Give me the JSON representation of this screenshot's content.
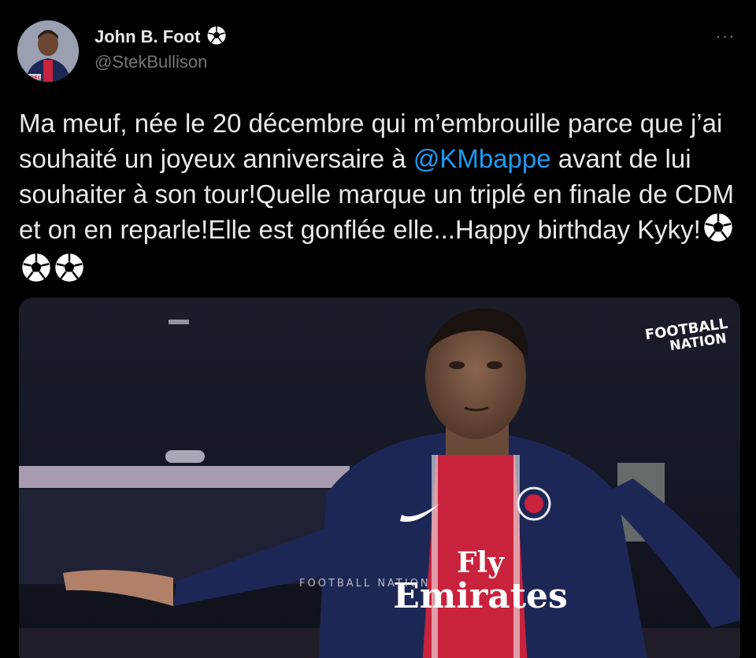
{
  "author": {
    "display_name": "John B. Foot",
    "handle": "@StekBullison",
    "name_badge_icon": "soccer-ball-icon",
    "avatar_alt": "profile-avatar"
  },
  "more_menu": {
    "label": "···"
  },
  "tweet": {
    "text_before_mention": "Ma meuf, née le 20 décembre qui m’embrouille parce que j’ai souhaité un joyeux anniversaire à ",
    "mention": "@KMbappe",
    "text_after_mention": " avant de lui souhaiter à son tour!Quelle marque un triplé en finale de CDM et on en reparle!Elle est gonflée elle...Happy birthday Kyky!",
    "trailing_emoji_count": 3,
    "trailing_emoji_icon": "soccer-ball-icon"
  },
  "media": {
    "type": "video-thumbnail",
    "watermark_line1": "FOOTBALL",
    "watermark_line2": "NATION",
    "shirt_sponsor_line1": "Fly",
    "shirt_sponsor_line2": "Emirates",
    "bottom_watermark": "FOOTBALL NATION"
  },
  "colors": {
    "background": "#000000",
    "text_primary": "#e7e9ea",
    "text_secondary": "#71767b",
    "link": "#1d9bf0",
    "jersey_navy": "#1d2756",
    "jersey_red": "#c8223c"
  }
}
